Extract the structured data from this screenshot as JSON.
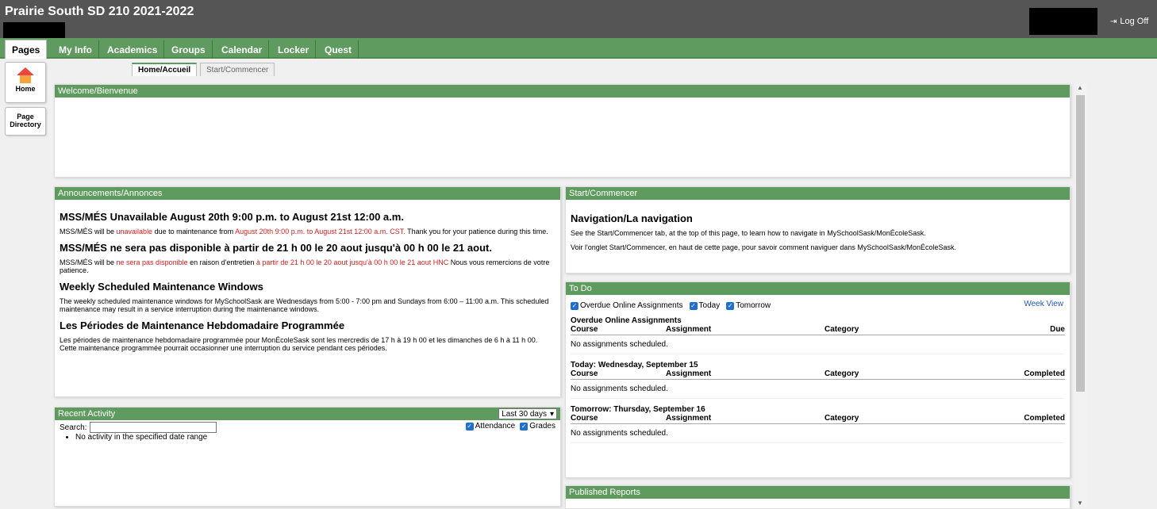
{
  "header": {
    "school": "Prairie South SD 210 2021-2022",
    "logoff": "Log Off"
  },
  "tabs": [
    "Pages",
    "My Info",
    "Academics",
    "Groups",
    "Calendar",
    "Locker",
    "Quest"
  ],
  "side": {
    "home": "Home",
    "page_directory": "Page Directory"
  },
  "subtabs": {
    "home": "Home/Accueil",
    "start": "Start/Commencer"
  },
  "welcome": {
    "title": "Welcome/Bienvenue"
  },
  "announcements": {
    "title": "Announcements/Annonces",
    "h1": "MSS/MÉS Unavailable August 20th 9:00 p.m. to August 21st 12:00 a.m.",
    "p1a": "MSS/MÉS will be ",
    "p1b": "unavailable",
    "p1c": " due to maintenance from ",
    "p1d": "August 20th 9:00 p.m. to August 21st 12:00 a.m. CST.",
    "p1e": " Thank you for your patience during this time.",
    "h2": "MSS/MÉS ne sera pas disponible à partir de 21 h 00 le 20 aout jusqu'à 00 h 00 le 21 aout.",
    "p2a": "MSS/MÉS will be ",
    "p2b": "ne sera pas disponible",
    "p2c": " en raison d'entretien ",
    "p2d": "à partir de 21 h 00 le 20 aout jusqu'à 00 h 00 le 21 aout HNC",
    "p2e": " Nous vous remercions de votre patience.",
    "h3": "Weekly Scheduled Maintenance Windows",
    "p3": "The weekly scheduled maintenance windows for MySchoolSask are Wednesdays from 5:00 - 7:00 pm and Sundays from 6:00 – 11:00 a.m. This scheduled maintenance may result in a service interruption during the maintenance windows.",
    "h4": "Les Périodes de Maintenance Hebdomadaire Programmée",
    "p4": "Les périodes de maintenance hebdomadaire programmée pour MonÉcoleSask sont les mercredis de 17 h à 19 h 00 et les dimanches de 6 h à 11 h 00. Cette maintenance programmée pourrait occasionner une interruption du service pendant ces périodes."
  },
  "recent": {
    "title": "Recent Activity",
    "period": "Last 30 days",
    "search_label": "Search:",
    "attendance": "Attendance",
    "grades": "Grades",
    "no_activity": "No activity in the specified date range"
  },
  "start": {
    "title": "Start/Commencer",
    "heading": "Navigation/La navigation",
    "line1": "See the Start/Commencer tab, at the top of this page, to learn how to navigate in MySchoolSask/MonÉcoleSask.",
    "line2": "Voir l'onglet Start/Commencer, en haut de cette page, pour savoir comment naviguer dans MySchoolSask/MonÉcoleSask."
  },
  "todo": {
    "title": "To Do",
    "week_view": "Week View",
    "f_overdue": "Overdue Online Assignments",
    "f_today": "Today",
    "f_tomorrow": "Tomorrow",
    "s1": "Overdue Online Assignments",
    "s2": "Today: Wednesday, September 15",
    "s3": "Tomorrow: Thursday, September 16",
    "col_course": "Course",
    "col_assign": "Assignment",
    "col_cat": "Category",
    "col_due": "Due",
    "col_completed": "Completed",
    "none": "No assignments scheduled."
  },
  "reports": {
    "title": "Published Reports"
  }
}
